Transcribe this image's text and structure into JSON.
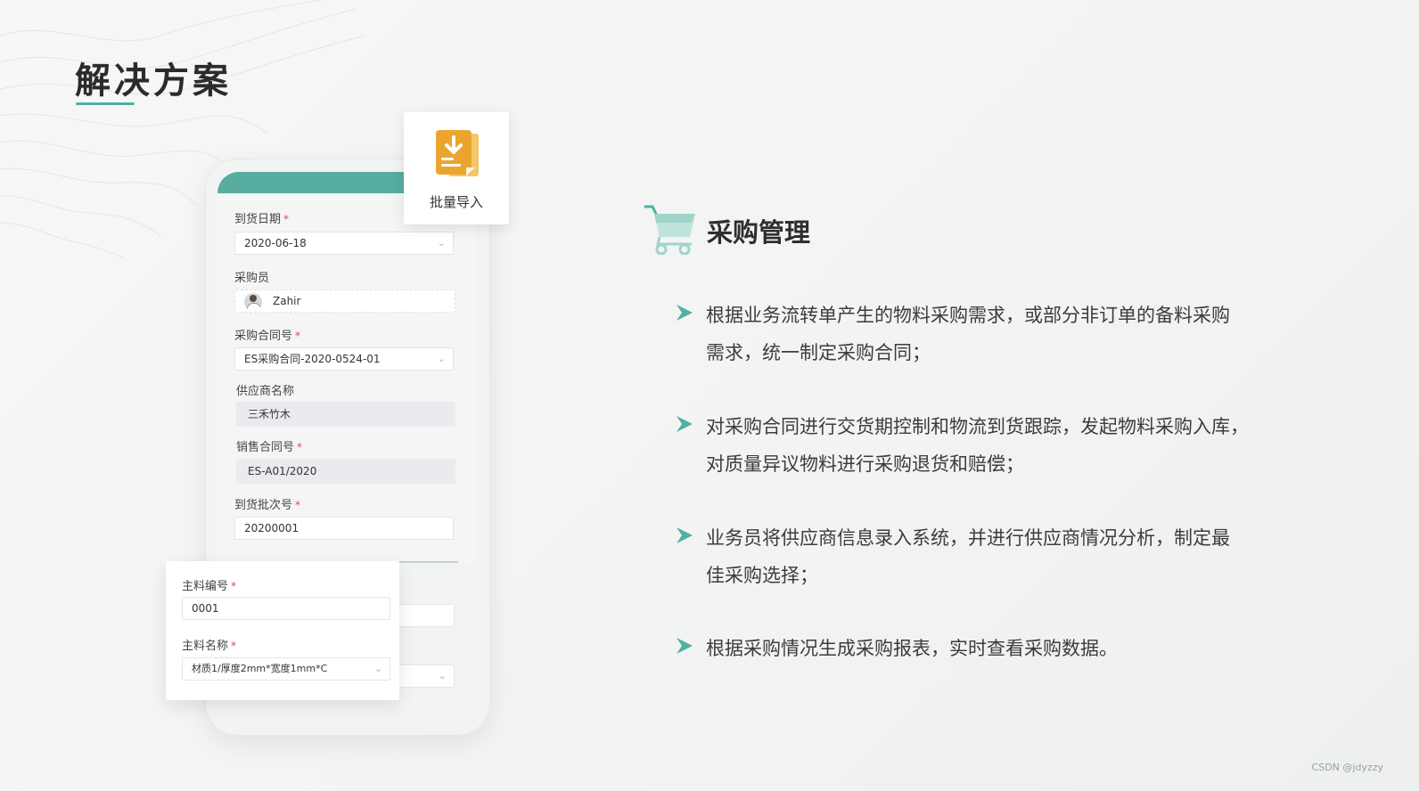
{
  "page": {
    "title": "解决方案",
    "accent_color": "#4fb0a4",
    "watermark": "CSDN @jdyzzy"
  },
  "import_card": {
    "label": "批量导入",
    "icon": "batch-import-icon"
  },
  "phone_form": {
    "arrival_date": {
      "label": "到货日期",
      "required": "*",
      "value": "2020-06-18"
    },
    "buyer": {
      "label": "采购员",
      "value": "Zahir"
    },
    "purchase_contract": {
      "label": "采购合同号",
      "required": "*",
      "value": "ES采购合同-2020-0524-01"
    },
    "supplier": {
      "label": "供应商名称",
      "value": "三禾竹木"
    },
    "sales_contract": {
      "label": "销售合同号",
      "required": "*",
      "value": "ES-A01/2020"
    },
    "batch_no": {
      "label": "到货批次号",
      "required": "*",
      "value": "20200001"
    }
  },
  "material_card": {
    "code": {
      "label": "主料编号",
      "required": "*",
      "value": "0001"
    },
    "name": {
      "label": "主料名称",
      "required": "*",
      "value": "材质1/厚度2mm*宽度1mm*C"
    }
  },
  "section": {
    "icon": "shopping-cart-icon",
    "title": "采购管理",
    "bullets": [
      {
        "line1": "根据业务流转单产生的物料采购需求，或部分非订单的备料采购",
        "line2": "需求，统一制定采购合同；"
      },
      {
        "line1": "对采购合同进行交货期控制和物流到货跟踪，发起物料采购入库，",
        "line2": "对质量异议物料进行采购退货和赔偿；"
      },
      {
        "line1": "业务员将供应商信息录入系统，并进行供应商情况分析，制定最",
        "line2": "佳采购选择；"
      },
      {
        "line1": "根据采购情况生成采购报表，实时查看采购数据。",
        "line2": ""
      }
    ]
  }
}
